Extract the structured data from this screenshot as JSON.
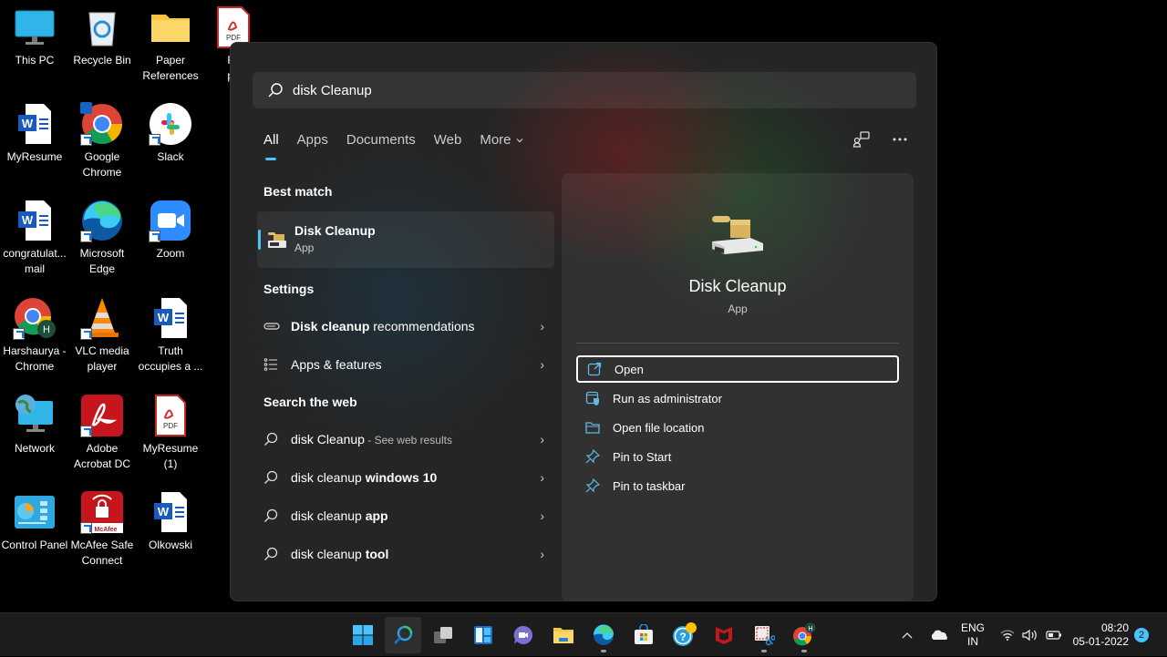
{
  "desktop": {
    "icons": [
      {
        "label": "This PC",
        "icon": "monitor-icon"
      },
      {
        "label": "Recycle Bin",
        "icon": "recycle-bin-icon"
      },
      {
        "label": "Paper\nReferences",
        "icon": "folder-icon"
      },
      {
        "label": "Res\npro",
        "icon": "pdf-icon"
      },
      {
        "label": "MyResume",
        "icon": "word-doc-icon"
      },
      {
        "label": "Google\nChrome",
        "icon": "chrome-icon"
      },
      {
        "label": "Slack",
        "icon": "slack-icon"
      },
      {
        "label": "congratulat...\nmail",
        "icon": "word-doc-icon"
      },
      {
        "label": "Microsoft\nEdge",
        "icon": "edge-icon"
      },
      {
        "label": "Zoom",
        "icon": "zoom-icon"
      },
      {
        "label": "Harshaurya -\nChrome",
        "icon": "chrome-profile-icon"
      },
      {
        "label": "VLC media\nplayer",
        "icon": "vlc-icon"
      },
      {
        "label": "Truth\noccupies a ...",
        "icon": "word-doc-icon"
      },
      {
        "label": "Network",
        "icon": "network-icon"
      },
      {
        "label": "Adobe\nAcrobat DC",
        "icon": "acrobat-icon"
      },
      {
        "label": "MyResume\n(1)",
        "icon": "pdf-icon"
      },
      {
        "label": "Control Panel",
        "icon": "control-panel-icon"
      },
      {
        "label": "McAfee Safe\nConnect",
        "icon": "mcafee-icon"
      },
      {
        "label": "Olkowski",
        "icon": "word-doc-icon"
      }
    ]
  },
  "search": {
    "query": "disk Cleanup",
    "tabs": [
      {
        "label": "All",
        "active": true
      },
      {
        "label": "Apps"
      },
      {
        "label": "Documents"
      },
      {
        "label": "Web"
      },
      {
        "label": "More"
      }
    ],
    "best_match_heading": "Best match",
    "best_match": {
      "title": "Disk Cleanup",
      "subtitle": "App"
    },
    "settings_heading": "Settings",
    "settings": [
      {
        "bold": "Disk cleanup",
        "rest": " recommendations",
        "icon": "storage-icon"
      },
      {
        "bold": "",
        "rest": "Apps & features",
        "icon": "list-icon"
      }
    ],
    "web_heading": "Search the web",
    "web": [
      {
        "normal": "disk Cleanup",
        "bold": "",
        "sub": " - See web results"
      },
      {
        "normal": "disk cleanup ",
        "bold": "windows 10",
        "sub": ""
      },
      {
        "normal": "disk cleanup ",
        "bold": "app",
        "sub": ""
      },
      {
        "normal": "disk cleanup ",
        "bold": "tool",
        "sub": ""
      }
    ],
    "preview": {
      "name": "Disk Cleanup",
      "type": "App",
      "actions": [
        {
          "label": "Open",
          "icon": "open-external-icon"
        },
        {
          "label": "Run as administrator",
          "icon": "shield-window-icon"
        },
        {
          "label": "Open file location",
          "icon": "folder-open-icon"
        },
        {
          "label": "Pin to Start",
          "icon": "pin-icon"
        },
        {
          "label": "Pin to taskbar",
          "icon": "pin-icon"
        }
      ]
    }
  },
  "taskbar": {
    "apps": [
      "start",
      "search",
      "task-view",
      "widgets",
      "teams-chat",
      "file-explorer",
      "edge",
      "store",
      "get-help",
      "mcafee",
      "snipping-tool",
      "chrome-profile"
    ],
    "tray": {
      "lang_top": "ENG",
      "lang_bottom": "IN",
      "time": "08:20",
      "date": "05-01-2022",
      "notifications": "2"
    }
  },
  "colors": {
    "accent": "#4cc2ff",
    "panel": "#252525",
    "taskbar": "#1c1c1c"
  }
}
